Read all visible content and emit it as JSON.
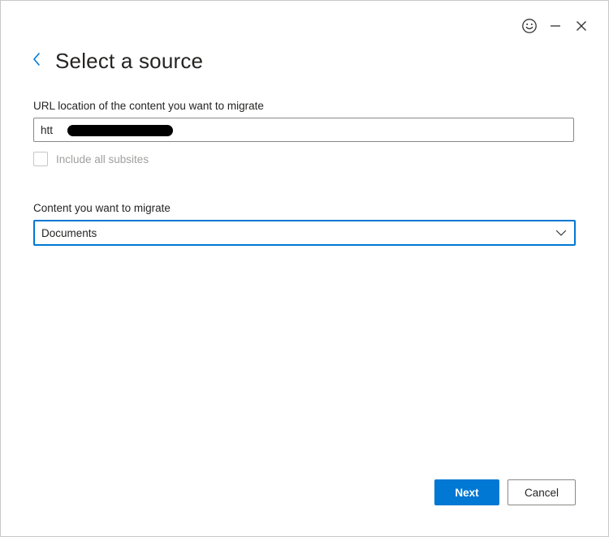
{
  "window": {
    "controls": {
      "feedback_icon": "smiley-icon",
      "minimize_icon": "minimize-icon",
      "close_icon": "close-icon"
    }
  },
  "header": {
    "back_icon": "chevron-left-icon",
    "title": "Select a source"
  },
  "url_field": {
    "label": "URL location of the content you want to migrate",
    "value": "htt"
  },
  "include_subsites": {
    "label": "Include all subsites",
    "checked": false,
    "disabled": true
  },
  "content_field": {
    "label": "Content you want to migrate",
    "selected": "Documents"
  },
  "actions": {
    "next_label": "Next",
    "cancel_label": "Cancel"
  },
  "colors": {
    "accent": "#0078d4",
    "text": "#252423",
    "disabled_text": "#a19f9d",
    "border": "#8a8886"
  }
}
